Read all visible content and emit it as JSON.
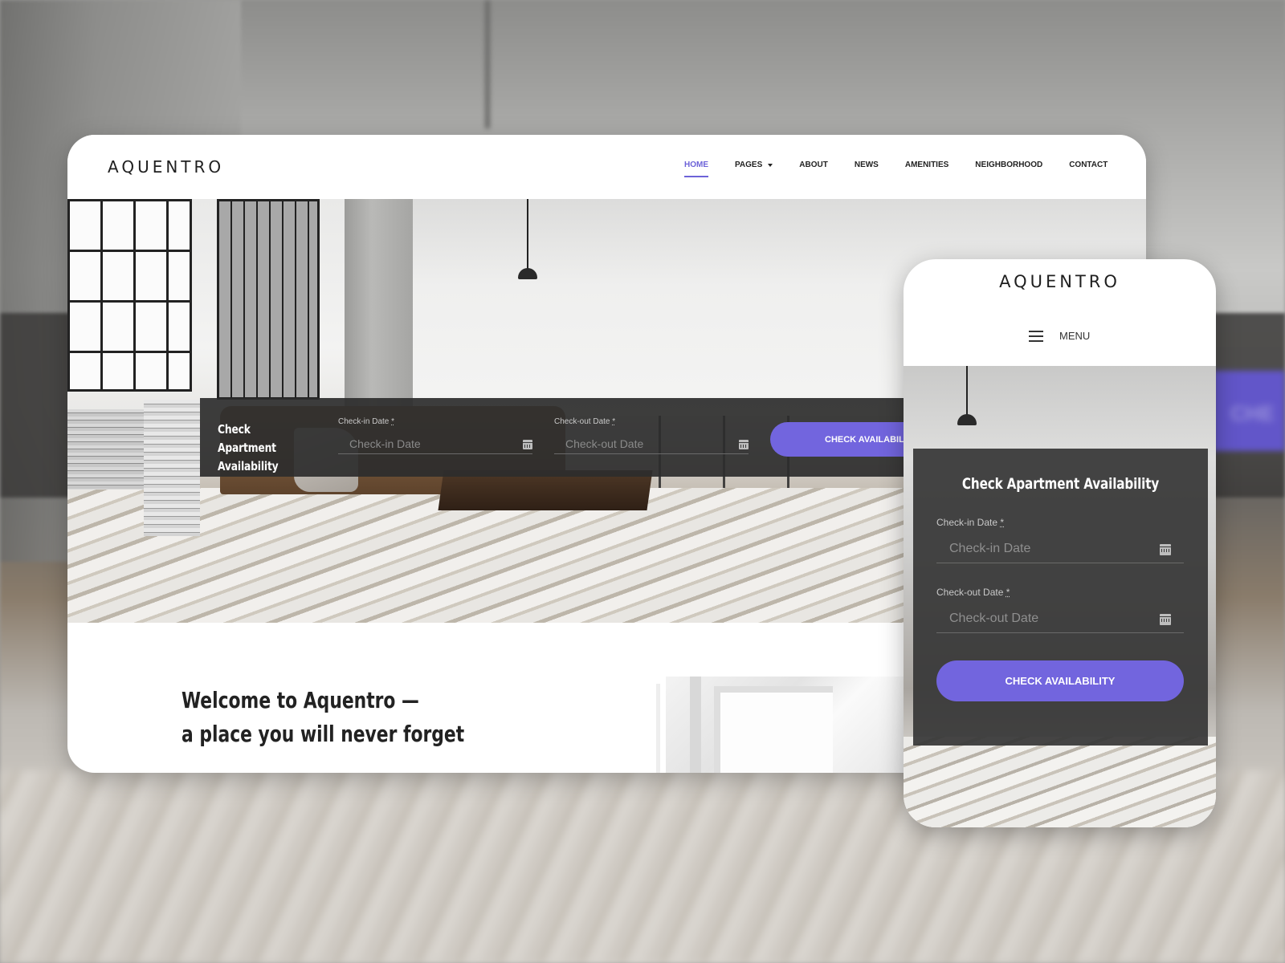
{
  "brand": {
    "logo_text": "AQUENTRO",
    "accent_color": "#7265de"
  },
  "desktop": {
    "nav": [
      {
        "label": "HOME",
        "active": true
      },
      {
        "label": "PAGES",
        "has_dropdown": true
      },
      {
        "label": "ABOUT"
      },
      {
        "label": "NEWS"
      },
      {
        "label": "AMENITIES"
      },
      {
        "label": "NEIGHBORHOOD"
      },
      {
        "label": "CONTACT"
      }
    ],
    "booking": {
      "title": "Check Apartment Availability",
      "checkin_label": "Check-in Date",
      "checkin_placeholder": "Check-in Date",
      "checkout_label": "Check-out Date",
      "checkout_placeholder": "Check-out Date",
      "required_mark": "*",
      "button_label": "CHECK AVAILABILITY"
    },
    "welcome": {
      "line1": "Welcome to Aquentro —",
      "line2": "a place you will never forget"
    }
  },
  "mobile": {
    "menu_label": "MENU",
    "booking": {
      "title": "Check Apartment Availability",
      "checkin_label": "Check-in Date",
      "checkin_placeholder": "Check-in Date",
      "checkout_label": "Check-out Date",
      "checkout_placeholder": "Check-out Date",
      "required_mark": "*",
      "button_label": "CHECK AVAILABILITY"
    }
  },
  "background": {
    "blurred_button_text": "CHE"
  }
}
